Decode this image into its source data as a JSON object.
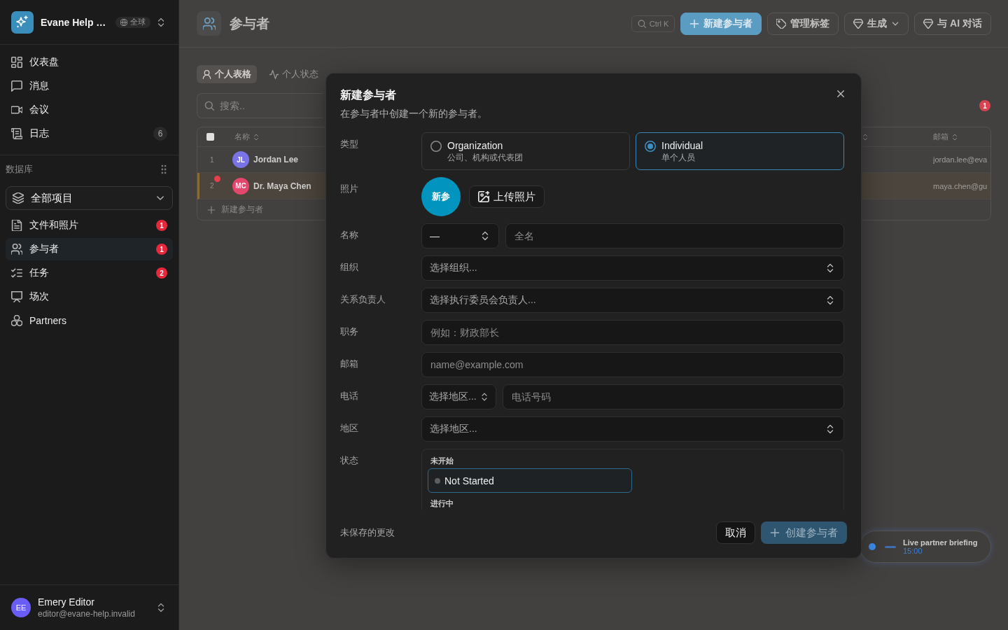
{
  "sidebar": {
    "workspace": {
      "name": "Evane Help …",
      "scope": "全球"
    },
    "nav": [
      {
        "label": "仪表盘",
        "selected": false
      },
      {
        "label": "消息",
        "selected": false
      },
      {
        "label": "会议",
        "selected": false
      },
      {
        "label": "日志",
        "count": "6",
        "alert": false,
        "selected": false
      }
    ],
    "section": {
      "title": "数据库",
      "filter": "全部项目",
      "items": [
        {
          "label": "文件和照片",
          "count": "1",
          "alert": true,
          "selected": false
        },
        {
          "label": "参与者",
          "count": "1",
          "alert": true,
          "selected": true
        },
        {
          "label": "任务",
          "count": "2",
          "alert": true,
          "selected": false
        },
        {
          "label": "场次",
          "selected": false
        },
        {
          "label": "Partners",
          "selected": false
        }
      ]
    },
    "user": {
      "initials": "EE",
      "name": "Emery Editor",
      "email": "editor@evane-help.invalid"
    }
  },
  "header": {
    "title": "参与者",
    "search_shortcut": "Ctrl K",
    "actions": [
      {
        "label": "新建参与者",
        "kind": "primary"
      },
      {
        "label": "管理标签",
        "kind": "tag"
      },
      {
        "label": "生成",
        "kind": "menu"
      },
      {
        "label": "与 AI 对话",
        "kind": "ai"
      }
    ]
  },
  "view_tabs": [
    {
      "label": "个人表格",
      "selected": true
    },
    {
      "label": "个人状态",
      "selected": false
    }
  ],
  "search": {
    "placeholder": "搜索.."
  },
  "notification_count": "1",
  "table": {
    "select_all_checked": false,
    "columns": [
      {
        "label": "名称"
      },
      {
        "label": "邮箱"
      }
    ],
    "rows": [
      {
        "number": "1",
        "initials": "JL",
        "color": "#7a73e6",
        "name": "Jordan Lee",
        "email": "jordan.lee@eva",
        "selected": false,
        "unread": false
      },
      {
        "number": "2",
        "initials": "MC",
        "color": "#e4466c",
        "name": "Dr. Maya Chen",
        "email": "maya.chen@gu",
        "selected": true,
        "unread": true
      }
    ],
    "add_row": "新建参与者"
  },
  "floating_event": {
    "title": "Live partner briefing",
    "time": "15:00"
  },
  "dialog": {
    "title": "新建参与者",
    "subtitle": "在参与者中创建一个新的参与者。",
    "fields": [
      {
        "kind": "type",
        "label": "类型",
        "options": [
          {
            "title": "Organization",
            "description": "公司、机构或代表团",
            "selected": false
          },
          {
            "title": "Individual",
            "description": "单个人员",
            "selected": true
          }
        ]
      },
      {
        "kind": "photo",
        "label": "照片",
        "initials": "新参",
        "button": "上传照片"
      },
      {
        "kind": "name",
        "label": "名称",
        "prefix_value": "—",
        "placeholder": "全名"
      },
      {
        "kind": "select",
        "label": "组织",
        "placeholder": "选择组织..."
      },
      {
        "kind": "select",
        "label": "关系负责人",
        "placeholder": "选择执行委员会负责人..."
      },
      {
        "kind": "text",
        "label": "职务",
        "placeholder": "例如：财政部长"
      },
      {
        "kind": "text",
        "label": "邮箱",
        "placeholder": "name@example.com"
      },
      {
        "kind": "phone",
        "label": "电话",
        "region": "选择地区...",
        "placeholder": "电话号码"
      },
      {
        "kind": "select",
        "label": "地区",
        "placeholder": "选择地区..."
      },
      {
        "kind": "status",
        "label": "状态",
        "groups": [
          {
            "label": "未开始",
            "options": [
              {
                "label": "Not Started",
                "color": "#5e5e5e",
                "selected": true
              }
            ]
          },
          {
            "label": "进行中"
          }
        ]
      }
    ],
    "footer_note": "未保存的更改",
    "cancel": "取消",
    "submit": "创建参与者",
    "submit_disabled": true
  }
}
